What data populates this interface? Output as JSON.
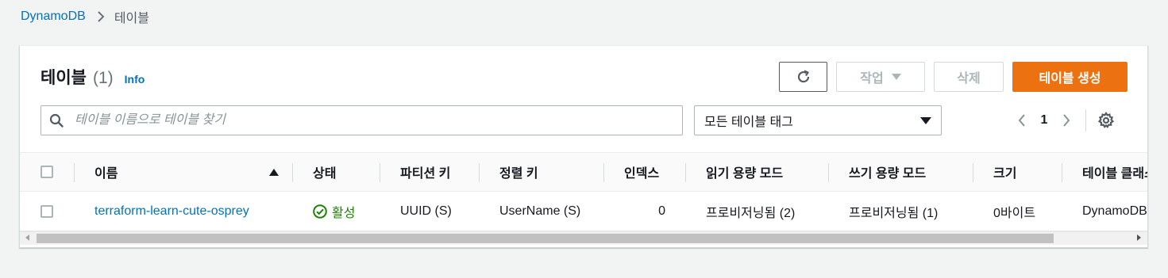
{
  "breadcrumb": {
    "root": "DynamoDB",
    "current": "테이블"
  },
  "panel": {
    "title": "테이블",
    "count": "(1)",
    "info": "Info"
  },
  "toolbar": {
    "actions_label": "작업",
    "delete_label": "삭제",
    "create_label": "테이블 생성"
  },
  "filter": {
    "search_placeholder": "테이블 이름으로 테이블 찾기",
    "tag_select_value": "모든 테이블 태그"
  },
  "pagination": {
    "page": "1"
  },
  "table": {
    "columns": [
      "이름",
      "상태",
      "파티션 키",
      "정렬 키",
      "인덱스",
      "읽기 용량 모드",
      "쓰기 용량 모드",
      "크기",
      "테이블 클래스"
    ],
    "rows": [
      {
        "name": "terraform-learn-cute-osprey",
        "status": "활성",
        "partition_key": "UUID (S)",
        "sort_key": "UserName (S)",
        "indexes": "0",
        "read_mode": "프로비저닝됨 (2)",
        "write_mode": "프로비저닝됨 (1)",
        "size": "0바이트",
        "table_class": "DynamoDB Standard"
      }
    ]
  },
  "colors": {
    "link": "#0073bb",
    "primary": "#ec7211",
    "success": "#1d8102",
    "disabled": "#aab7b8"
  }
}
